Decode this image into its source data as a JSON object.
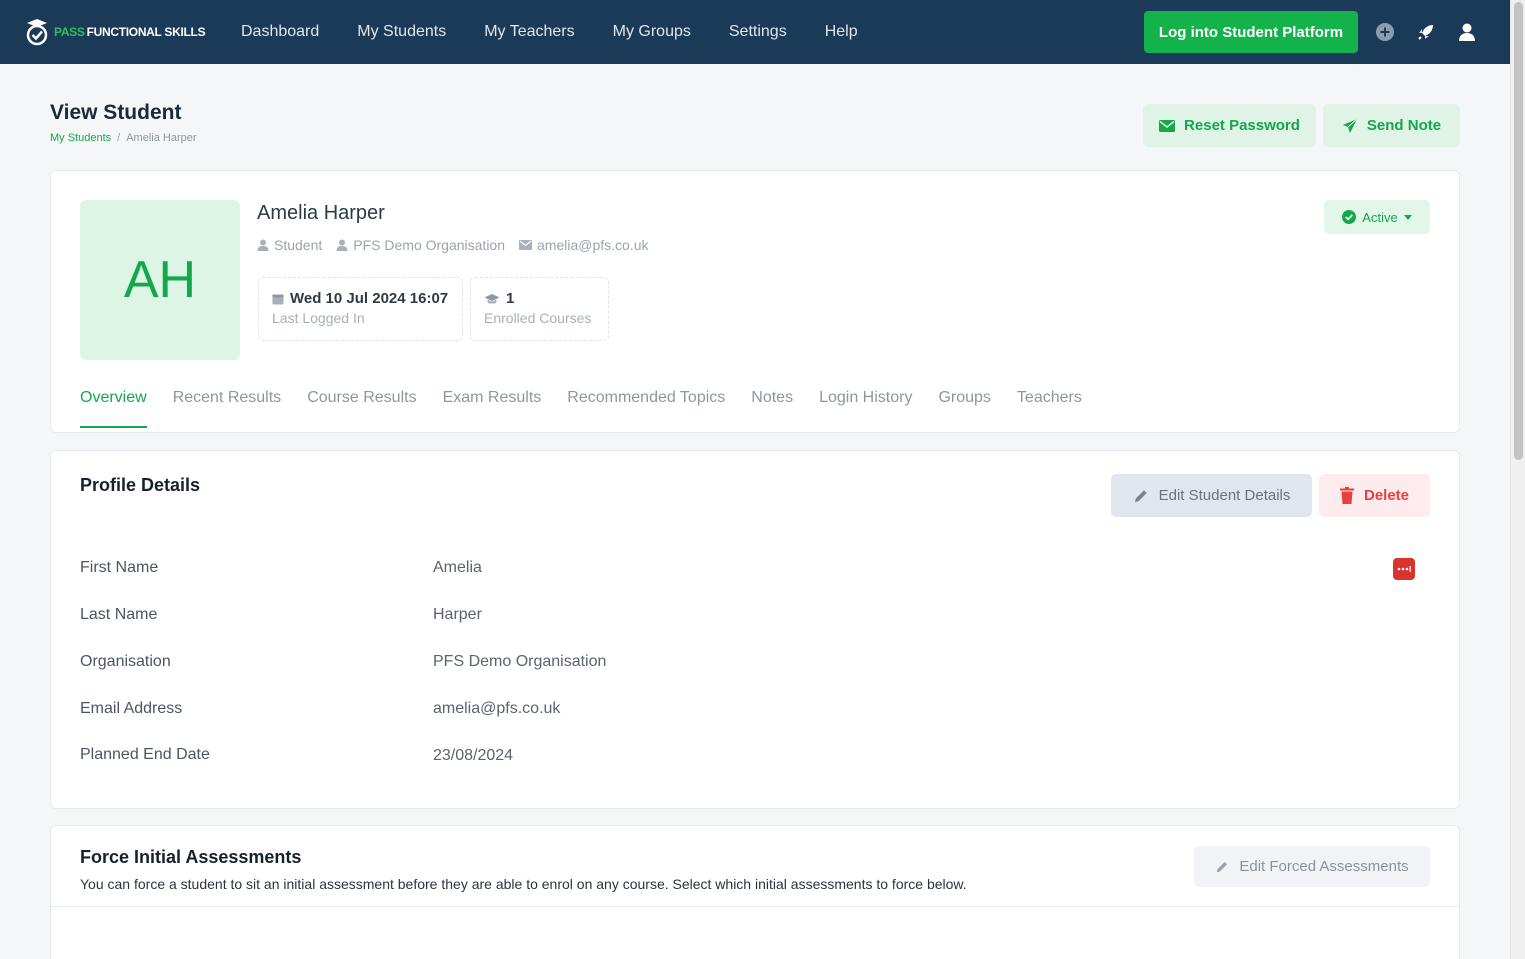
{
  "nav": {
    "brand_part1": "PASS",
    "brand_part2": "FUNCTIONAL SKILLS",
    "links": [
      "Dashboard",
      "My Students",
      "My Teachers",
      "My Groups",
      "Settings",
      "Help"
    ],
    "login_button": "Log into Student Platform",
    "icons": [
      "plus-circle-icon",
      "rocket-icon",
      "user-icon"
    ]
  },
  "header": {
    "title": "View Student",
    "breadcrumb": {
      "parent": "My Students",
      "current": "Amelia Harper"
    },
    "reset_password": "Reset Password",
    "send_note": "Send Note"
  },
  "student": {
    "initials": "AH",
    "name": "Amelia Harper",
    "role": "Student",
    "organisation": "PFS Demo Organisation",
    "email": "amelia@pfs.co.uk",
    "last_logged_in": "Wed 10 Jul 2024 16:07",
    "last_logged_in_label": "Last Logged In",
    "enrolled_courses": "1",
    "enrolled_courses_label": "Enrolled Courses",
    "status": "Active"
  },
  "tabs": [
    "Overview",
    "Recent Results",
    "Course Results",
    "Exam Results",
    "Recommended Topics",
    "Notes",
    "Login History",
    "Groups",
    "Teachers"
  ],
  "active_tab": "Overview",
  "profile": {
    "title": "Profile Details",
    "edit_button": "Edit Student Details",
    "delete_button": "Delete",
    "rows": [
      {
        "label": "First Name",
        "value": "Amelia"
      },
      {
        "label": "Last Name",
        "value": "Harper"
      },
      {
        "label": "Organisation",
        "value": "PFS Demo Organisation"
      },
      {
        "label": "Email Address",
        "value": "amelia@pfs.co.uk"
      },
      {
        "label": "Planned End Date",
        "value": "23/08/2024"
      }
    ]
  },
  "force": {
    "title": "Force Initial Assessments",
    "description": "You can force a student to sit an initial assessment before they are able to enrol on any course. Select which initial assessments to force below.",
    "edit_button": "Edit Forced Assessments"
  },
  "colors": {
    "nav_bg": "#1b3a57",
    "accent": "#13b24a",
    "danger": "#e8413c"
  }
}
